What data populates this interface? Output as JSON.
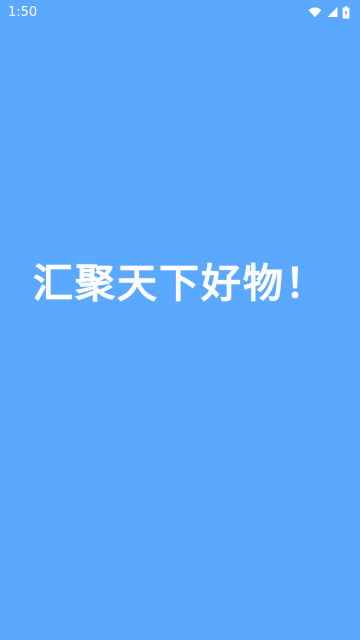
{
  "status_bar": {
    "time": "1:50",
    "icons": [
      "wifi-icon",
      "cell-signal-icon",
      "battery-icon"
    ]
  },
  "splash": {
    "slogan": "汇聚天下好物！"
  },
  "colors": {
    "background": "#5AA8FF",
    "text": "#FFFFFF"
  }
}
